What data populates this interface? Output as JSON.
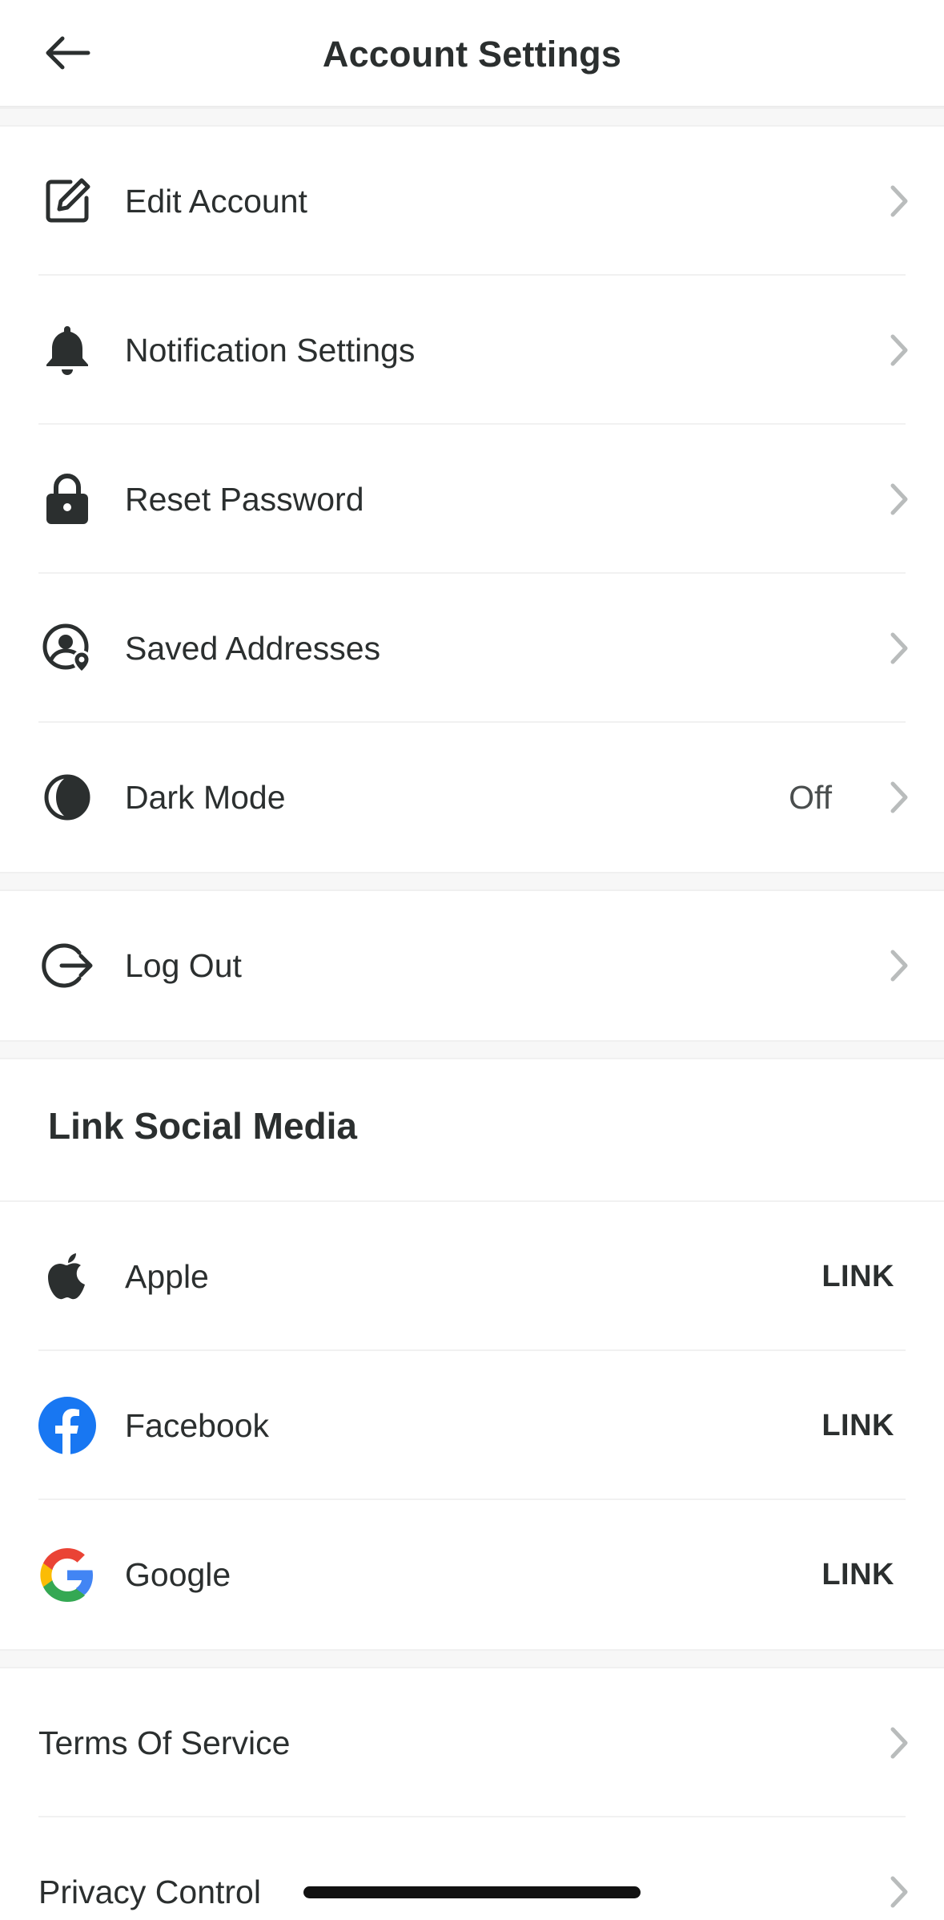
{
  "header": {
    "title": "Account Settings",
    "back_icon": "back-arrow-icon"
  },
  "settings": [
    {
      "label": "Edit Account",
      "icon": "edit-icon"
    },
    {
      "label": "Notification Settings",
      "icon": "bell-icon"
    },
    {
      "label": "Reset Password",
      "icon": "lock-icon"
    },
    {
      "label": "Saved Addresses",
      "icon": "location-user-icon"
    },
    {
      "label": "Dark Mode",
      "icon": "moon-icon",
      "value": "Off"
    }
  ],
  "logout": {
    "label": "Log Out",
    "icon": "logout-icon"
  },
  "social": {
    "title": "Link Social Media",
    "items": [
      {
        "label": "Apple",
        "icon": "apple-icon",
        "action": "LINK"
      },
      {
        "label": "Facebook",
        "icon": "facebook-icon",
        "action": "LINK",
        "color": "#1877F2"
      },
      {
        "label": "Google",
        "icon": "google-icon",
        "action": "LINK"
      }
    ]
  },
  "legal": [
    {
      "label": "Terms Of Service"
    },
    {
      "label": "Privacy Control"
    }
  ]
}
